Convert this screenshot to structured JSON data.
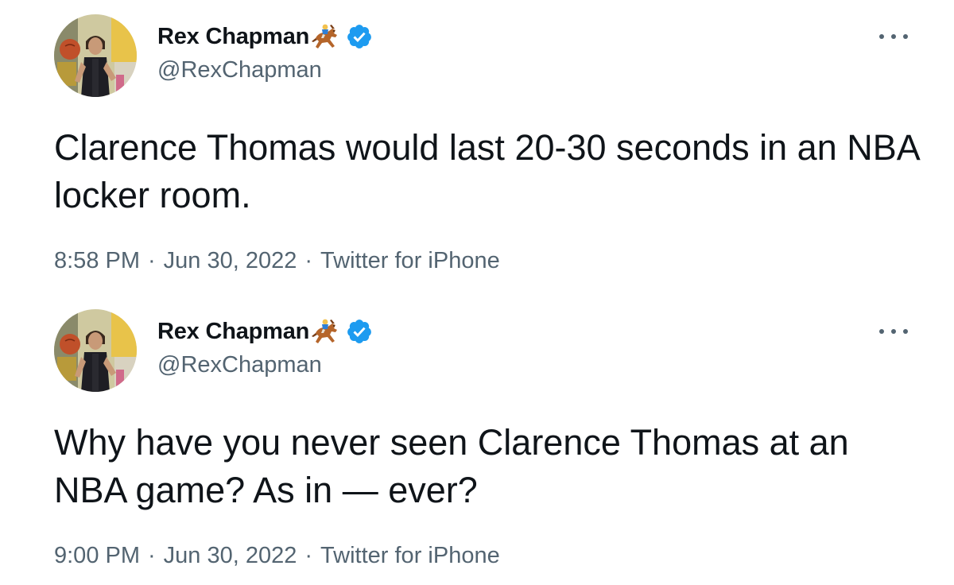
{
  "colors": {
    "text_primary": "#0f1419",
    "text_secondary": "#536471",
    "verified_blue": "#1d9bf0",
    "background": "#ffffff"
  },
  "tweets": [
    {
      "author": {
        "display_name": "Rex Chapman",
        "emoji_icon": "horse-racing-emoji",
        "verified_icon": "verified-badge-icon",
        "handle": "@RexChapman"
      },
      "text": "Clarence Thomas would last 20-30 seconds in an NBA locker room.",
      "time": "8:58 PM",
      "date": "Jun 30, 2022",
      "source": "Twitter for iPhone",
      "separator": "·"
    },
    {
      "author": {
        "display_name": "Rex Chapman",
        "emoji_icon": "horse-racing-emoji",
        "verified_icon": "verified-badge-icon",
        "handle": "@RexChapman"
      },
      "text": "Why have you never seen Clarence Thomas at an NBA game? As in — ever?",
      "time": "9:00 PM",
      "date": "Jun 30, 2022",
      "source": "Twitter for iPhone",
      "separator": "·"
    }
  ]
}
